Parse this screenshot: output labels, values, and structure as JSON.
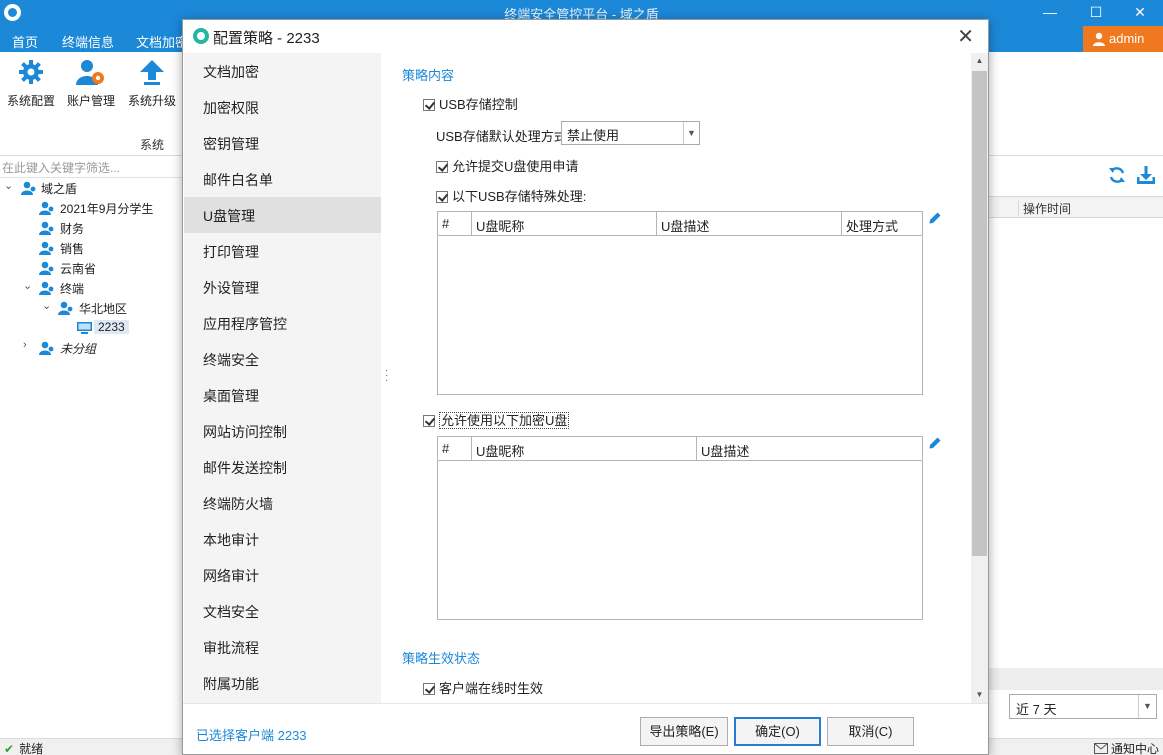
{
  "app": {
    "title": "终端安全管控平台 - 域之盾",
    "window_controls": {
      "minimize": "—",
      "maximize": "☐",
      "close": "✕"
    }
  },
  "menu": {
    "items": [
      "首页",
      "终端信息",
      "文档加密"
    ],
    "user": "admin"
  },
  "ribbon": {
    "buttons": [
      {
        "label": "系统配置",
        "icon": "gear-icon"
      },
      {
        "label": "账户管理",
        "icon": "user-settings-icon"
      },
      {
        "label": "系统升级",
        "icon": "upgrade-arrow-icon"
      }
    ],
    "group_label": "系统"
  },
  "search": {
    "placeholder": "在此键入关键字筛选..."
  },
  "tree": {
    "root": "域之盾",
    "items": [
      "2021年9月分学生",
      "财务",
      "销售",
      "云南省",
      "终端"
    ],
    "sub_group": "华北地区",
    "terminal": "2233",
    "ungrouped": "未分组"
  },
  "right_pane": {
    "column_header": "操作时间",
    "range": "近 7 天"
  },
  "status": {
    "ready": "就绪",
    "notify": "通知中心"
  },
  "dialog": {
    "title": "配置策略 - 2233",
    "nav": [
      "文档加密",
      "加密权限",
      "密钥管理",
      "邮件白名单",
      "U盘管理",
      "打印管理",
      "外设管理",
      "应用程序管控",
      "终端安全",
      "桌面管理",
      "网站访问控制",
      "邮件发送控制",
      "终端防火墙",
      "本地审计",
      "网络审计",
      "文档安全",
      "审批流程",
      "附属功能"
    ],
    "active_nav": "U盘管理",
    "content": {
      "section_policy": "策略内容",
      "usb_control": "USB存储控制",
      "default_mode_label": "USB存储默认处理方式",
      "default_mode_value": "禁止使用",
      "allow_request": "允许提交U盘使用申请",
      "special_handling": "以下USB存储特殊处理:",
      "table1_headers": [
        "#",
        "U盘昵称",
        "U盘描述",
        "处理方式"
      ],
      "allow_encrypted": "允许使用以下加密U盘",
      "table2_headers": [
        "#",
        "U盘昵称",
        "U盘描述"
      ],
      "section_effect": "策略生效状态",
      "online_effect": "客户端在线时生效"
    },
    "footer": {
      "selected_client": "已选择客户端 2233",
      "export": "导出策略(E)",
      "ok": "确定(O)",
      "cancel": "取消(C)"
    }
  },
  "colors": {
    "brand_blue": "#1c88d8",
    "admin_orange": "#f0781e",
    "dialog_teal": "#25b5a5"
  }
}
